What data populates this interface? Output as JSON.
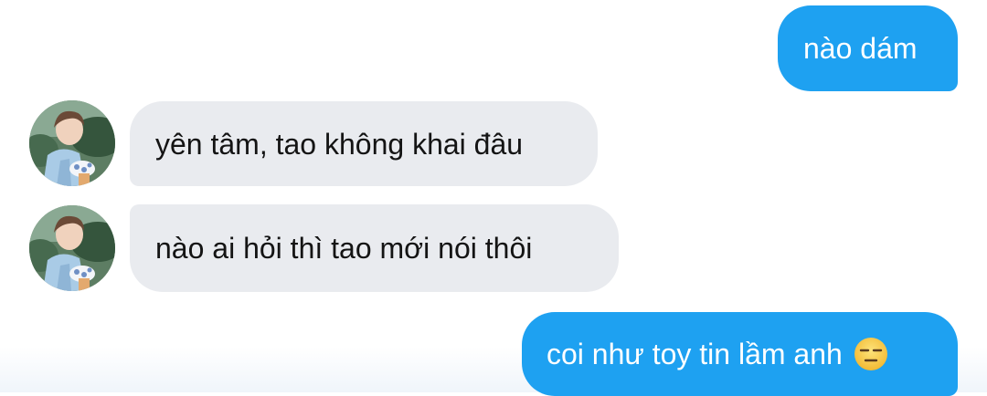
{
  "conversation": {
    "messages": [
      {
        "direction": "outgoing",
        "text": "nào dám"
      },
      {
        "direction": "incoming",
        "text": "yên tâm, tao không khai đâu"
      },
      {
        "direction": "incoming",
        "text": "nào ai hỏi thì  tao mới nói thôi"
      },
      {
        "direction": "outgoing",
        "text": "coi như toy tin lầm anh",
        "emoji": "expressionless-face"
      }
    ],
    "avatar_icon": "profile-photo-avatar"
  },
  "colors": {
    "outgoing_bubble": "#1ea1f1",
    "incoming_bubble": "#e9ebef",
    "outgoing_text": "#ffffff",
    "incoming_text": "#141414",
    "emoji_face": "#f7c338"
  }
}
